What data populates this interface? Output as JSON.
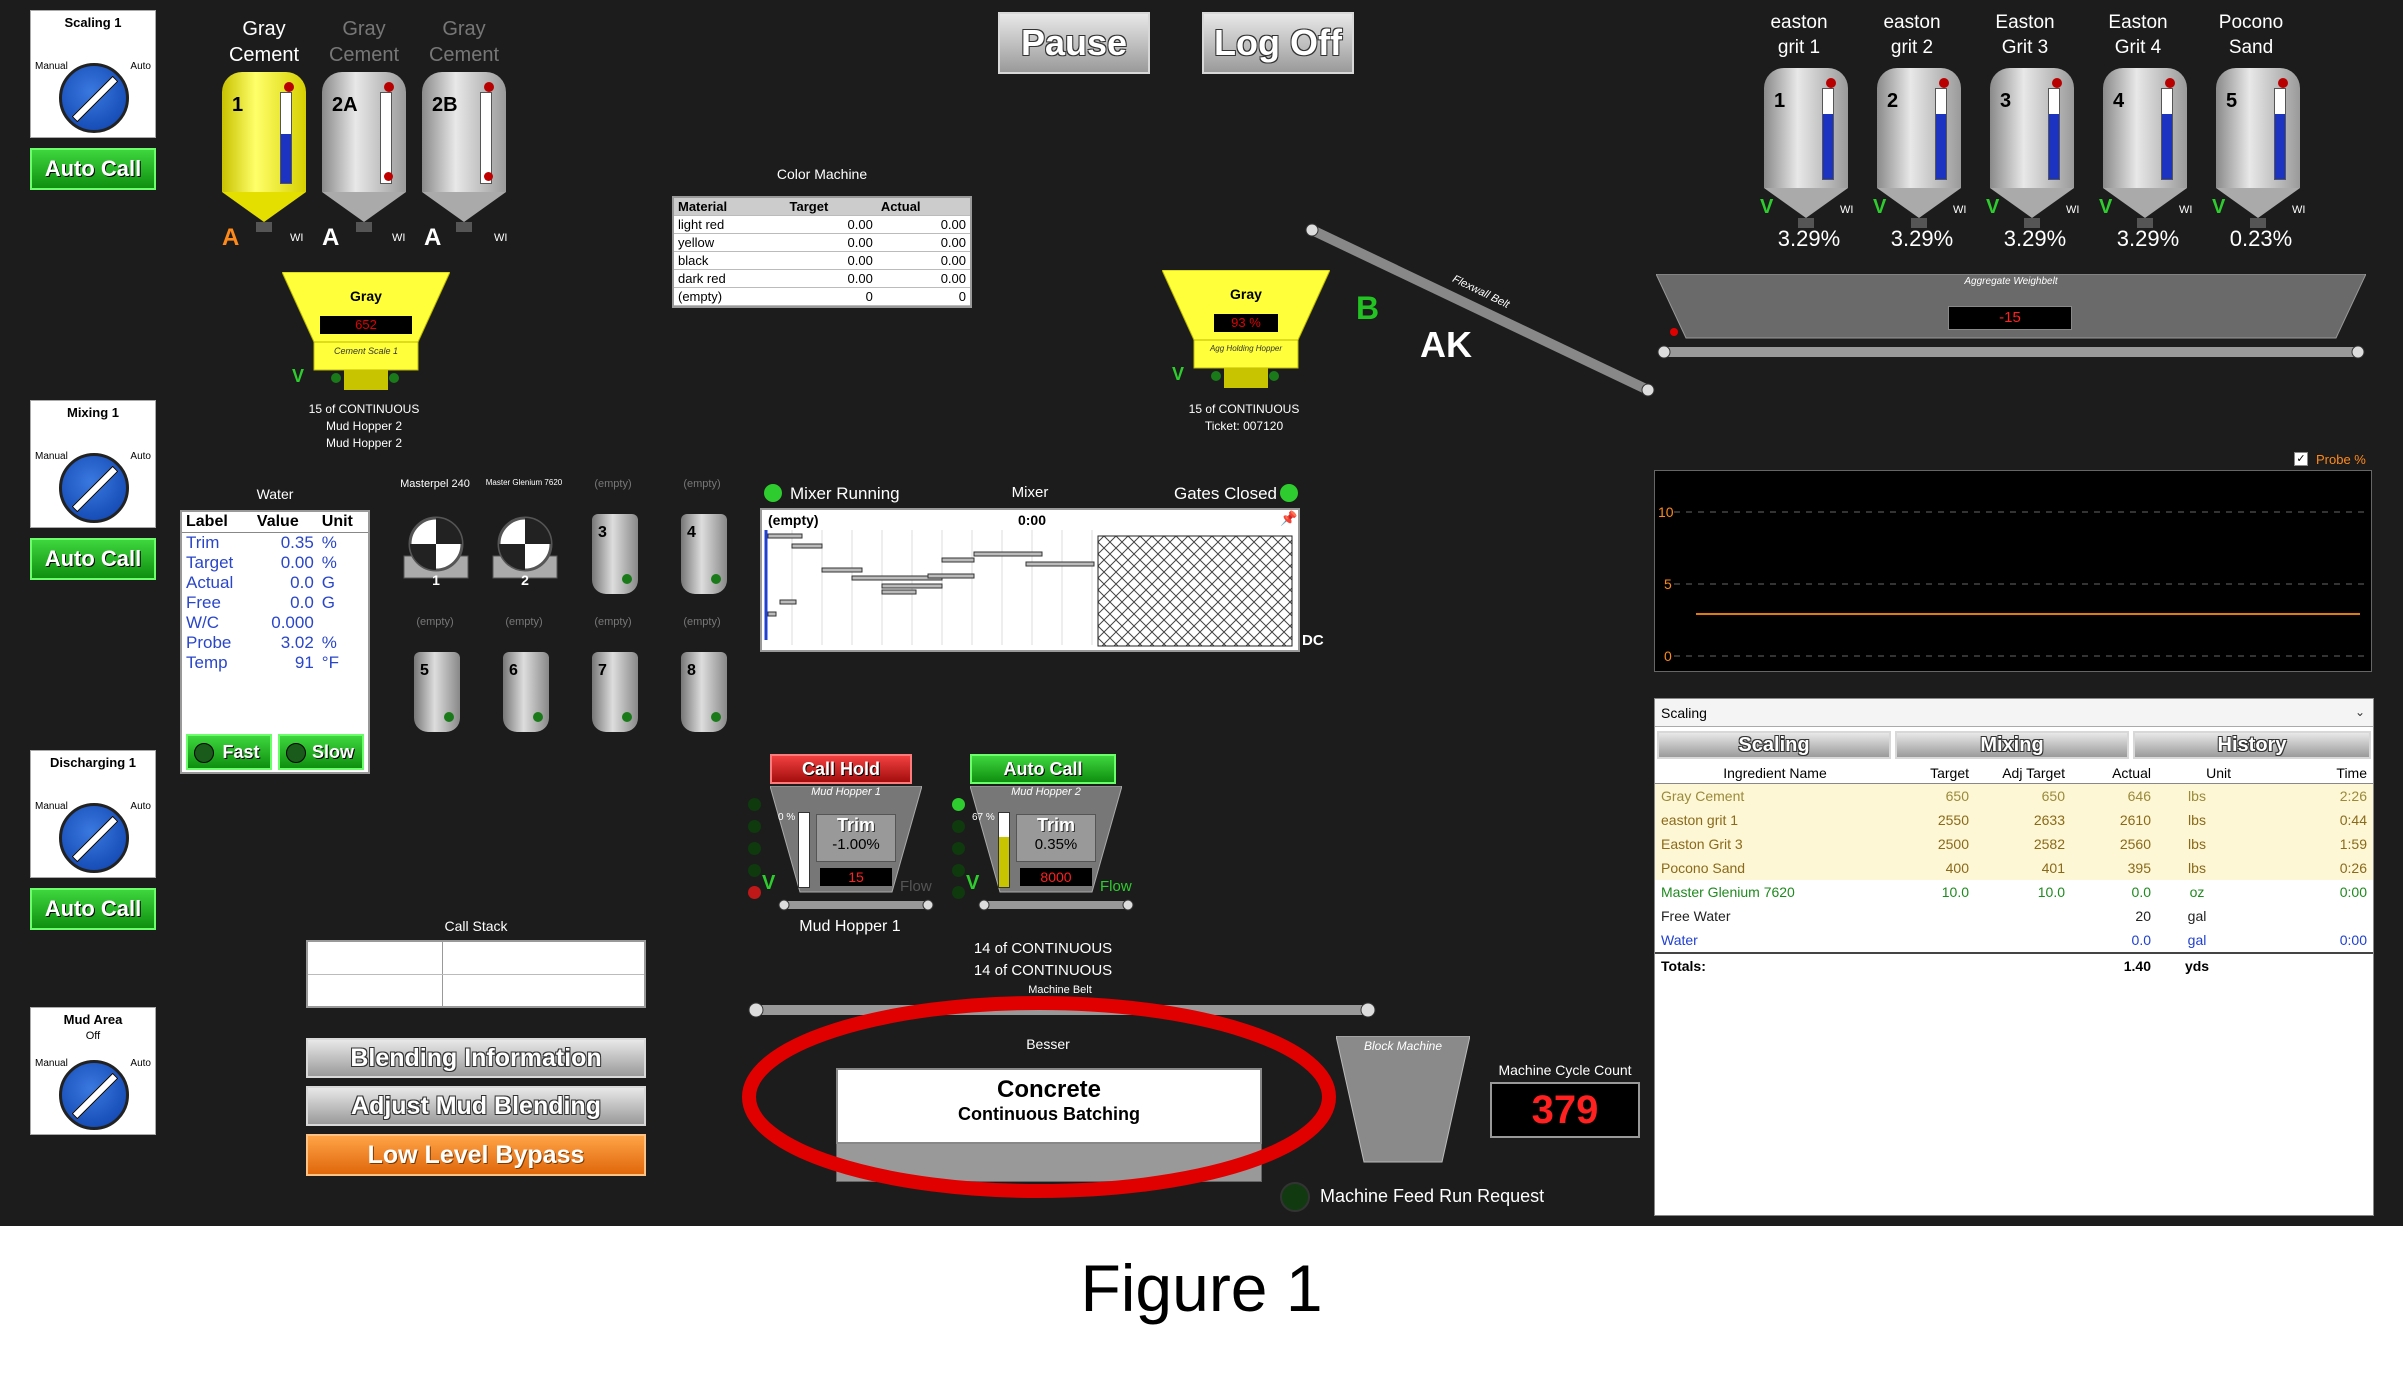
{
  "selectors": [
    {
      "title": "Scaling 1",
      "sub": "",
      "manual": "Manual",
      "auto": "Auto",
      "button": "Auto Call"
    },
    {
      "title": "Mixing 1",
      "sub": "",
      "manual": "Manual",
      "auto": "Auto",
      "button": "Auto Call"
    },
    {
      "title": "Discharging 1",
      "sub": "",
      "manual": "Manual",
      "auto": "Auto",
      "button": "Auto Call"
    },
    {
      "title": "Mud Area",
      "sub": "Off",
      "manual": "Manual",
      "auto": "Auto",
      "button": ""
    }
  ],
  "cement_silos": [
    {
      "label": "Gray Cement",
      "num": "1",
      "mode": "A",
      "wi": "WI",
      "color": "#ffff40",
      "level": 0.55
    },
    {
      "label": "Gray Cement",
      "num": "2A",
      "mode": "A",
      "wi": "WI",
      "color": "#cccccc",
      "level": 0.0
    },
    {
      "label": "Gray Cement",
      "num": "2B",
      "mode": "A",
      "wi": "WI",
      "color": "#cccccc",
      "level": 0.0
    }
  ],
  "cement_scale": {
    "title": "Gray",
    "value": "652",
    "caption": "Cement Scale 1",
    "v": "V",
    "line1": "15 of CONTINUOUS",
    "line2": "Mud Hopper 2",
    "line3": "Mud Hopper 2"
  },
  "top_buttons": {
    "pause": "Pause",
    "logoff": "Log Off"
  },
  "color_machine": {
    "title": "Color Machine",
    "headers": [
      "Material",
      "Target",
      "Actual"
    ],
    "rows": [
      [
        "light red",
        "0.00",
        "0.00"
      ],
      [
        "yellow",
        "0.00",
        "0.00"
      ],
      [
        "black",
        "0.00",
        "0.00"
      ],
      [
        "dark red",
        "0.00",
        "0.00"
      ],
      [
        "(empty)",
        "0",
        "0"
      ]
    ]
  },
  "agg_hopper": {
    "title": "Gray",
    "value": "93 %",
    "caption": "Agg Holding Hopper",
    "v": "V",
    "line1": "15 of CONTINUOUS",
    "line2": "Ticket: 007120"
  },
  "markers": {
    "b": "B",
    "ak": "AK",
    "flexwall": "Flexwall Belt"
  },
  "agg_silos": [
    {
      "label1": "easton",
      "label2": "grit 1",
      "num": "1",
      "v": "V",
      "wi": "WI",
      "pct": "3.29%",
      "level": 0.72
    },
    {
      "label1": "easton",
      "label2": "grit 2",
      "num": "2",
      "v": "V",
      "wi": "WI",
      "pct": "3.29%",
      "level": 0.72
    },
    {
      "label1": "Easton",
      "label2": "Grit 3",
      "num": "3",
      "v": "V",
      "wi": "WI",
      "pct": "3.29%",
      "level": 0.72
    },
    {
      "label1": "Easton",
      "label2": "Grit 4",
      "num": "4",
      "v": "V",
      "wi": "WI",
      "pct": "3.29%",
      "level": 0.72
    },
    {
      "label1": "Pocono",
      "label2": "Sand",
      "num": "5",
      "v": "V",
      "wi": "WI",
      "pct": "0.23%",
      "level": 0.72
    }
  ],
  "agg_weighbelt": {
    "title": "Aggregate Weighbelt",
    "value": "-15"
  },
  "probe_chart": {
    "checkbox_label": "Probe %",
    "ticks": [
      "10",
      "5",
      "0"
    ]
  },
  "water": {
    "title": "Water",
    "headers": [
      "Label",
      "Value",
      "Unit"
    ],
    "rows": [
      [
        "Trim",
        "0.35",
        "%"
      ],
      [
        "Target",
        "0.00",
        "%"
      ],
      [
        "Actual",
        "0.0",
        "G"
      ],
      [
        "Free",
        "0.0",
        "G"
      ],
      [
        "W/C",
        "0.000",
        ""
      ],
      [
        "Probe",
        "3.02",
        "%"
      ],
      [
        "Temp",
        "91",
        "°F"
      ]
    ],
    "fast": "Fast",
    "slow": "Slow"
  },
  "admix": [
    {
      "label": "Masterpel 240",
      "num": "1",
      "type": "pump"
    },
    {
      "label": "Master Glenium 7620",
      "num": "2",
      "type": "pump"
    },
    {
      "label": "(empty)",
      "num": "3",
      "type": "tank"
    },
    {
      "label": "(empty)",
      "num": "4",
      "type": "tank"
    },
    {
      "label": "(empty)",
      "num": "5",
      "type": "tank"
    },
    {
      "label": "(empty)",
      "num": "6",
      "type": "tank"
    },
    {
      "label": "(empty)",
      "num": "7",
      "type": "tank"
    },
    {
      "label": "(empty)",
      "num": "8",
      "type": "tank"
    }
  ],
  "mixer": {
    "running": "Mixer Running",
    "title": "Mixer",
    "gates": "Gates Closed",
    "content": "(empty)",
    "time": "0:00",
    "dc": "DC"
  },
  "mud_hopper_1": {
    "button": "Call Hold",
    "title": "Mud Hopper 1",
    "trim_label": "Trim",
    "trim": "-1.00%",
    "value": "15",
    "pct": "0 %",
    "v": "V",
    "flow": "Flow",
    "caption": "Mud Hopper 1"
  },
  "mud_hopper_2": {
    "button": "Auto Call",
    "title": "Mud Hopper 2",
    "trim_label": "Trim",
    "trim": "0.35%",
    "value": "8000",
    "pct": "67 %",
    "v": "V",
    "flow": "Flow",
    "line1": "14 of CONTINUOUS",
    "line2": "14 of CONTINUOUS",
    "belt": "Machine Belt"
  },
  "call_stack": {
    "title": "Call Stack"
  },
  "bottom_buttons": {
    "blending": "Blending Information",
    "adjust": "Adjust Mud Blending",
    "bypass": "Low Level Bypass"
  },
  "besser": {
    "title": "Besser",
    "product": "Concrete",
    "mode": "Continuous Batching"
  },
  "block_machine": {
    "title": "Block Machine"
  },
  "cycle": {
    "title": "Machine Cycle Count",
    "value": "379"
  },
  "feed": {
    "label": "Machine Feed Run Request"
  },
  "scaling_panel": {
    "dropdown": "Scaling",
    "tabs": [
      "Scaling",
      "Mixing",
      "History"
    ],
    "headers": [
      "Ingredient Name",
      "Target",
      "Adj Target",
      "Actual",
      "Unit",
      "Time"
    ],
    "rows": [
      {
        "cells": [
          "Gray Cement",
          "650",
          "650",
          "646",
          "lbs",
          "2:26"
        ],
        "color": "#9a8a3a",
        "bg": "#fdf7d6"
      },
      {
        "cells": [
          "easton grit 1",
          "2550",
          "2633",
          "2610",
          "lbs",
          "0:44"
        ],
        "color": "#8a6a1a",
        "bg": "#fdf7d6"
      },
      {
        "cells": [
          "Easton Grit 3",
          "2500",
          "2582",
          "2560",
          "lbs",
          "1:59"
        ],
        "color": "#8a6a1a",
        "bg": "#fdf7d6"
      },
      {
        "cells": [
          "Pocono Sand",
          "400",
          "401",
          "395",
          "lbs",
          "0:26"
        ],
        "color": "#8a6a1a",
        "bg": "#fdf7d6"
      },
      {
        "cells": [
          "Master Glenium 7620",
          "10.0",
          "10.0",
          "0.0",
          "oz",
          "0:00"
        ],
        "color": "#1f8a1f",
        "bg": "#ffffff"
      },
      {
        "cells": [
          "Free Water",
          "",
          "",
          "20",
          "gal",
          ""
        ],
        "color": "#222222",
        "bg": "#ffffff"
      },
      {
        "cells": [
          "Water",
          "",
          "",
          "0.0",
          "gal",
          "0:00"
        ],
        "color": "#2040d0",
        "bg": "#ffffff"
      }
    ],
    "totals": [
      "Totals:",
      "",
      "",
      "1.40",
      "yds",
      ""
    ]
  },
  "caption": "Figure 1"
}
